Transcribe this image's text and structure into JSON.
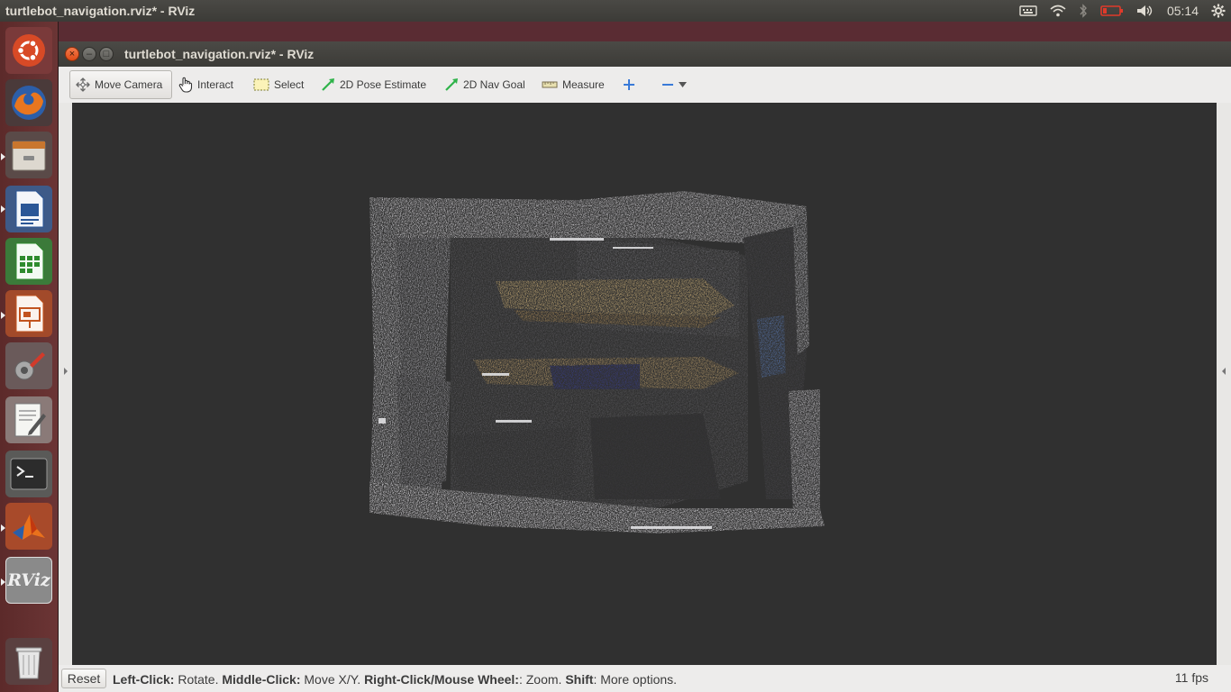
{
  "top_panel": {
    "title": "turtlebot_navigation.rviz* - RViz",
    "clock": "05:14",
    "tray_icons": [
      "keyboard-icon",
      "wifi-icon",
      "bluetooth-icon",
      "battery-icon",
      "volume-icon",
      "gear-icon"
    ]
  },
  "launcher": {
    "items": [
      "ubuntu-dash-icon",
      "firefox-icon",
      "files-icon",
      "writer-icon",
      "calc-icon",
      "impress-icon",
      "system-settings-icon",
      "text-editor-icon",
      "terminal-icon",
      "matlab-icon",
      "rviz-icon",
      "trash-icon"
    ],
    "rviz_label": "RViz"
  },
  "window": {
    "title": "turtlebot_navigation.rviz* - RViz",
    "close_glyph": "×",
    "min_glyph": "–",
    "max_glyph": "□"
  },
  "toolbar": {
    "move_camera": "Move Camera",
    "interact": "Interact",
    "select": "Select",
    "pose_estimate": "2D Pose Estimate",
    "nav_goal": "2D Nav Goal",
    "measure": "Measure"
  },
  "statusbar": {
    "reset": "Reset",
    "left_click_key": "Left-Click:",
    "left_click_val": " Rotate. ",
    "middle_click_key": "Middle-Click:",
    "middle_click_val": " Move X/Y. ",
    "right_click_key": "Right-Click/Mouse Wheel:",
    "right_click_val": ": Zoom. ",
    "shift_key": "Shift",
    "shift_val": ": More options.",
    "fps": "11 fps"
  },
  "colors": {
    "viewport_bg": "#303030",
    "launcher_bg": "#5c2a2a",
    "panel_bg": "#3c3b37",
    "close_button": "#df4b16"
  }
}
